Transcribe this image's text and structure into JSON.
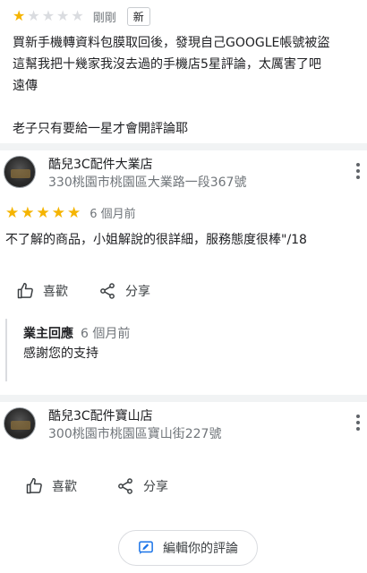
{
  "top_review": {
    "rating": 1,
    "max_rating": 5,
    "time": "剛剛",
    "badge": "新",
    "text": "買新手機轉資料包膜取回後，發現自己GOOGLE帳號被盜\n這幫我把十幾家我沒去過的手機店5星評論，太厲害了吧\n遠傳\n\n老子只有要給一星才會開評論耶"
  },
  "reviews": [
    {
      "business_name": "酷兒3C配件大業店",
      "address": "330桃園市桃園區大業路一段367號",
      "rating": 5,
      "time": "6 個月前",
      "text": "不了解的商品，小姐解說的很詳細，服務態度很棒\"/18",
      "like_label": "喜歡",
      "share_label": "分享",
      "owner_reply": {
        "title": "業主回應",
        "time": "6 個月前",
        "text": "感謝您的支持"
      }
    },
    {
      "business_name": "酷兒3C配件寶山店",
      "address": "300桃園市桃園區寶山街227號"
    }
  ],
  "bottom_actions": {
    "like_label": "喜歡",
    "share_label": "分享"
  },
  "edit_button": {
    "label": "編輯你的評論"
  },
  "colors": {
    "star_on": "#f5b400",
    "star_off": "#dadce0",
    "section_bg": "#f1f3f4",
    "accent": "#1a73e8"
  },
  "icons": [
    "star-icon",
    "more-vert-icon",
    "thumb-up-icon",
    "share-icon",
    "edit-review-icon"
  ]
}
